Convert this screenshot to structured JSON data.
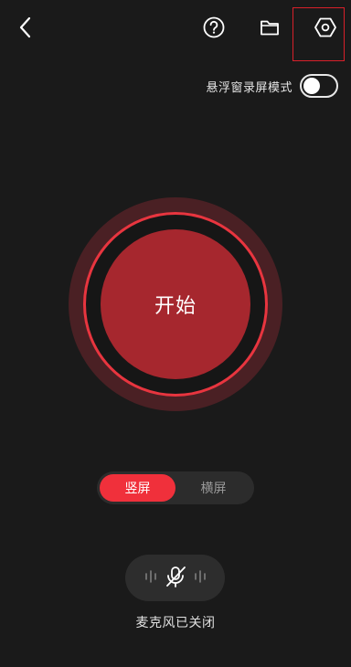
{
  "header": {
    "back_icon": "chevron-left-icon",
    "help_icon": "question-circle-icon",
    "folder_icon": "folder-icon",
    "settings_icon": "settings-hex-icon"
  },
  "floating_mode": {
    "label": "悬浮窗录屏模式",
    "enabled": false
  },
  "record_button": {
    "label": "开始"
  },
  "orientation": {
    "options": [
      "竖屏",
      "横屏"
    ],
    "selected": "竖屏"
  },
  "microphone": {
    "icon": "mic-off-icon",
    "status": "麦克风已关闭"
  },
  "colors": {
    "accent": "#f0303b",
    "record_fill": "#a6272e",
    "highlight": "#d8202a",
    "background": "#1a1a1a"
  }
}
